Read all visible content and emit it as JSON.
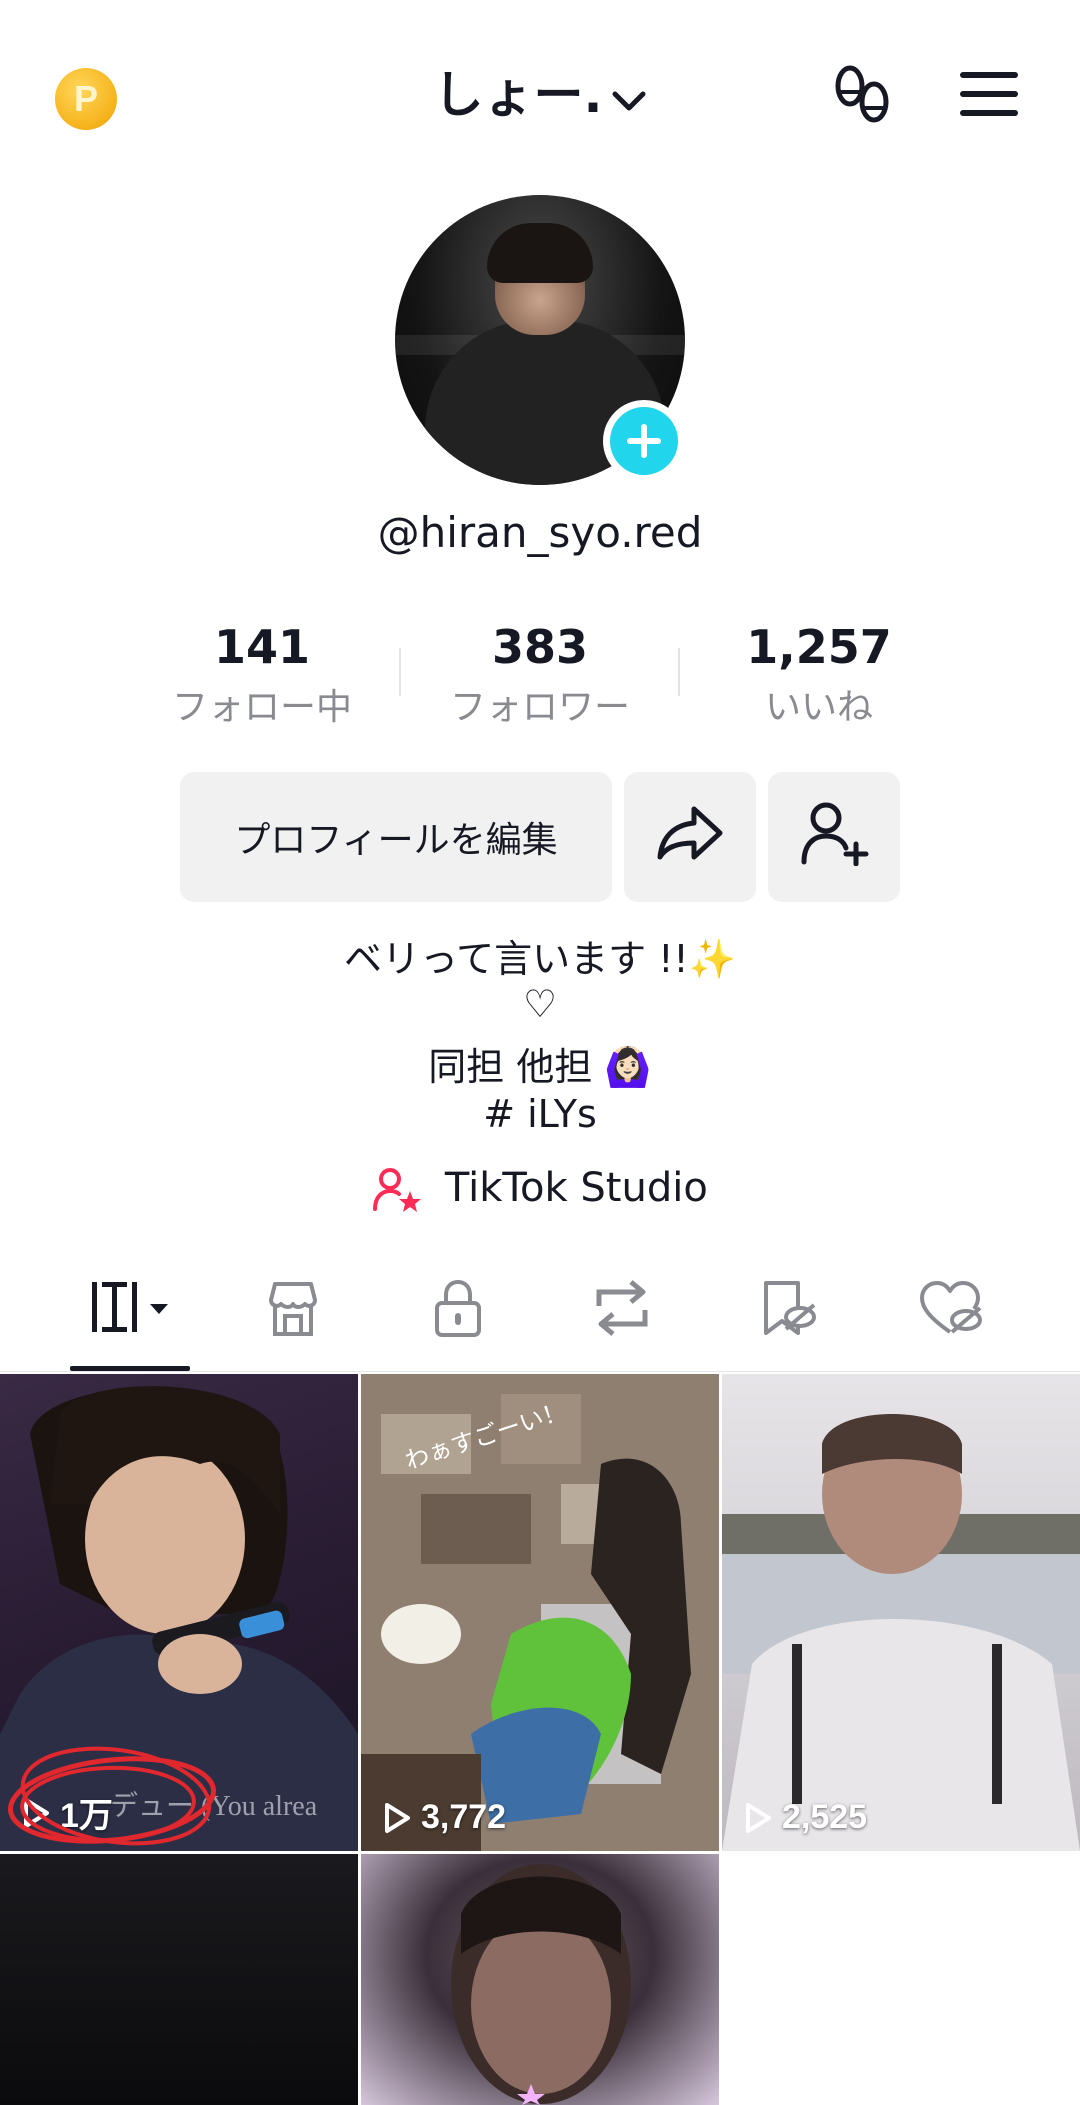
{
  "header": {
    "coin_letter": "P",
    "username": "しょー.",
    "coin_icon": "coin-icon",
    "left_icon": "footprint-icon",
    "menu_icon": "hamburger-menu-icon"
  },
  "profile": {
    "handle": "@hiran_syo.red"
  },
  "stats": [
    {
      "value": "141",
      "label": "フォロー中"
    },
    {
      "value": "383",
      "label": "フォロワー"
    },
    {
      "value": "1,257",
      "label": "いいね"
    }
  ],
  "actions": {
    "edit_profile": "プロフィールを編集"
  },
  "bio": {
    "line1": "ベリって言います !!✨",
    "line2": "♡",
    "line3": "同担 他担 🙆🏻‍♀️",
    "line4": "#  iLYs"
  },
  "studio": {
    "label": "TikTok Studio"
  },
  "tabs": [
    "videos-grid-icon",
    "shop-icon",
    "lock-icon",
    "repost-icon",
    "saved-icon",
    "liked-icon"
  ],
  "videos": [
    {
      "views": "1万",
      "caption": "デュー (You alrea"
    },
    {
      "views": "3,772",
      "caption": "わぁすごーい！"
    },
    {
      "views": "2,525"
    },
    {
      "views": ""
    },
    {
      "views": ""
    }
  ],
  "colors": {
    "accent_cyan": "#20d5ec",
    "studio_pink": "#fe2c55",
    "annotation_red": "#e0282e"
  }
}
